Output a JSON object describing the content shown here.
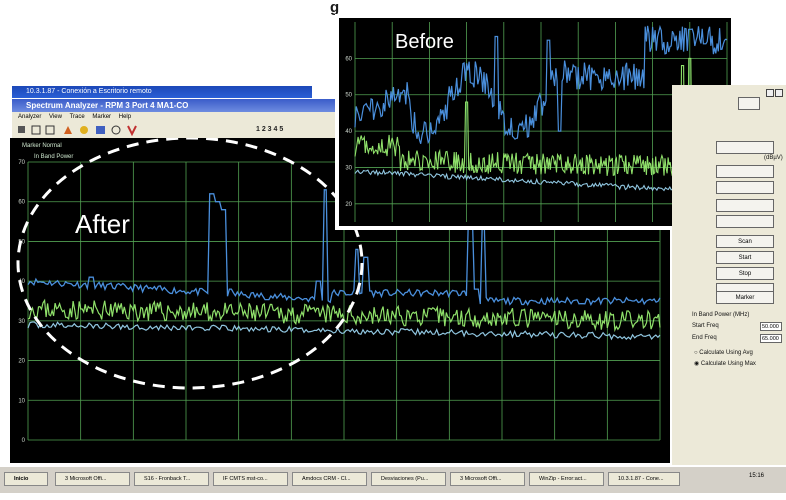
{
  "headline": "g",
  "window": {
    "title": "10.3.1.87 - Conexión a Escritorio remoto",
    "app_title": "Spectrum Analyzer - RPM 3 Port 4 MA1-CO",
    "menu": [
      "Analyzer",
      "View",
      "Trace",
      "Marker",
      "Help"
    ],
    "toolbar_right": "1 2 3 4 5",
    "marker_label": "Marker Normal",
    "measure_label": "In Band Power"
  },
  "plot_after": {
    "label": "After",
    "y_ticks": [
      "70",
      "60",
      "50",
      "40",
      "30",
      "20",
      "10",
      "0"
    ],
    "colors": {
      "bg": "#000000",
      "grid": "#52a052",
      "upper": "#4a8fdc",
      "noise": "#8fe06a",
      "lower": "#90c6e0"
    }
  },
  "plot_before": {
    "label": "Before",
    "y_ticks": [
      "60",
      "50",
      "40",
      "30",
      "20"
    ],
    "colors": {
      "bg": "#000000",
      "grid": "#52a052",
      "upper": "#4a8fdc",
      "noise": "#8fe06a",
      "lower": "#90c6e0"
    }
  },
  "right_panel": {
    "units": "(dBµV)",
    "buttons": [
      "Scan",
      "Start",
      "Stop",
      "Marker"
    ],
    "inband_title": "In Band Power (MHz)",
    "start_label": "Start Freq",
    "start_value": "50.000",
    "end_label": "End Freq",
    "end_value": "65.000",
    "radio_avg": "Calculate Using Avg",
    "radio_max": "Calculate Using Max"
  },
  "taskbar": {
    "start": "Inicio",
    "tasks": [
      "3 Microsoft Offi...",
      "S16 - Fronback T...",
      "IF CMTS mst-co...",
      "Amdocs CRM - Cl...",
      "Desviaciones (Pu...",
      "3 Microsoft Offi...",
      "WinZip - Error:act...",
      "10.3.1.87 - Cone..."
    ],
    "clock": "15:16"
  }
}
